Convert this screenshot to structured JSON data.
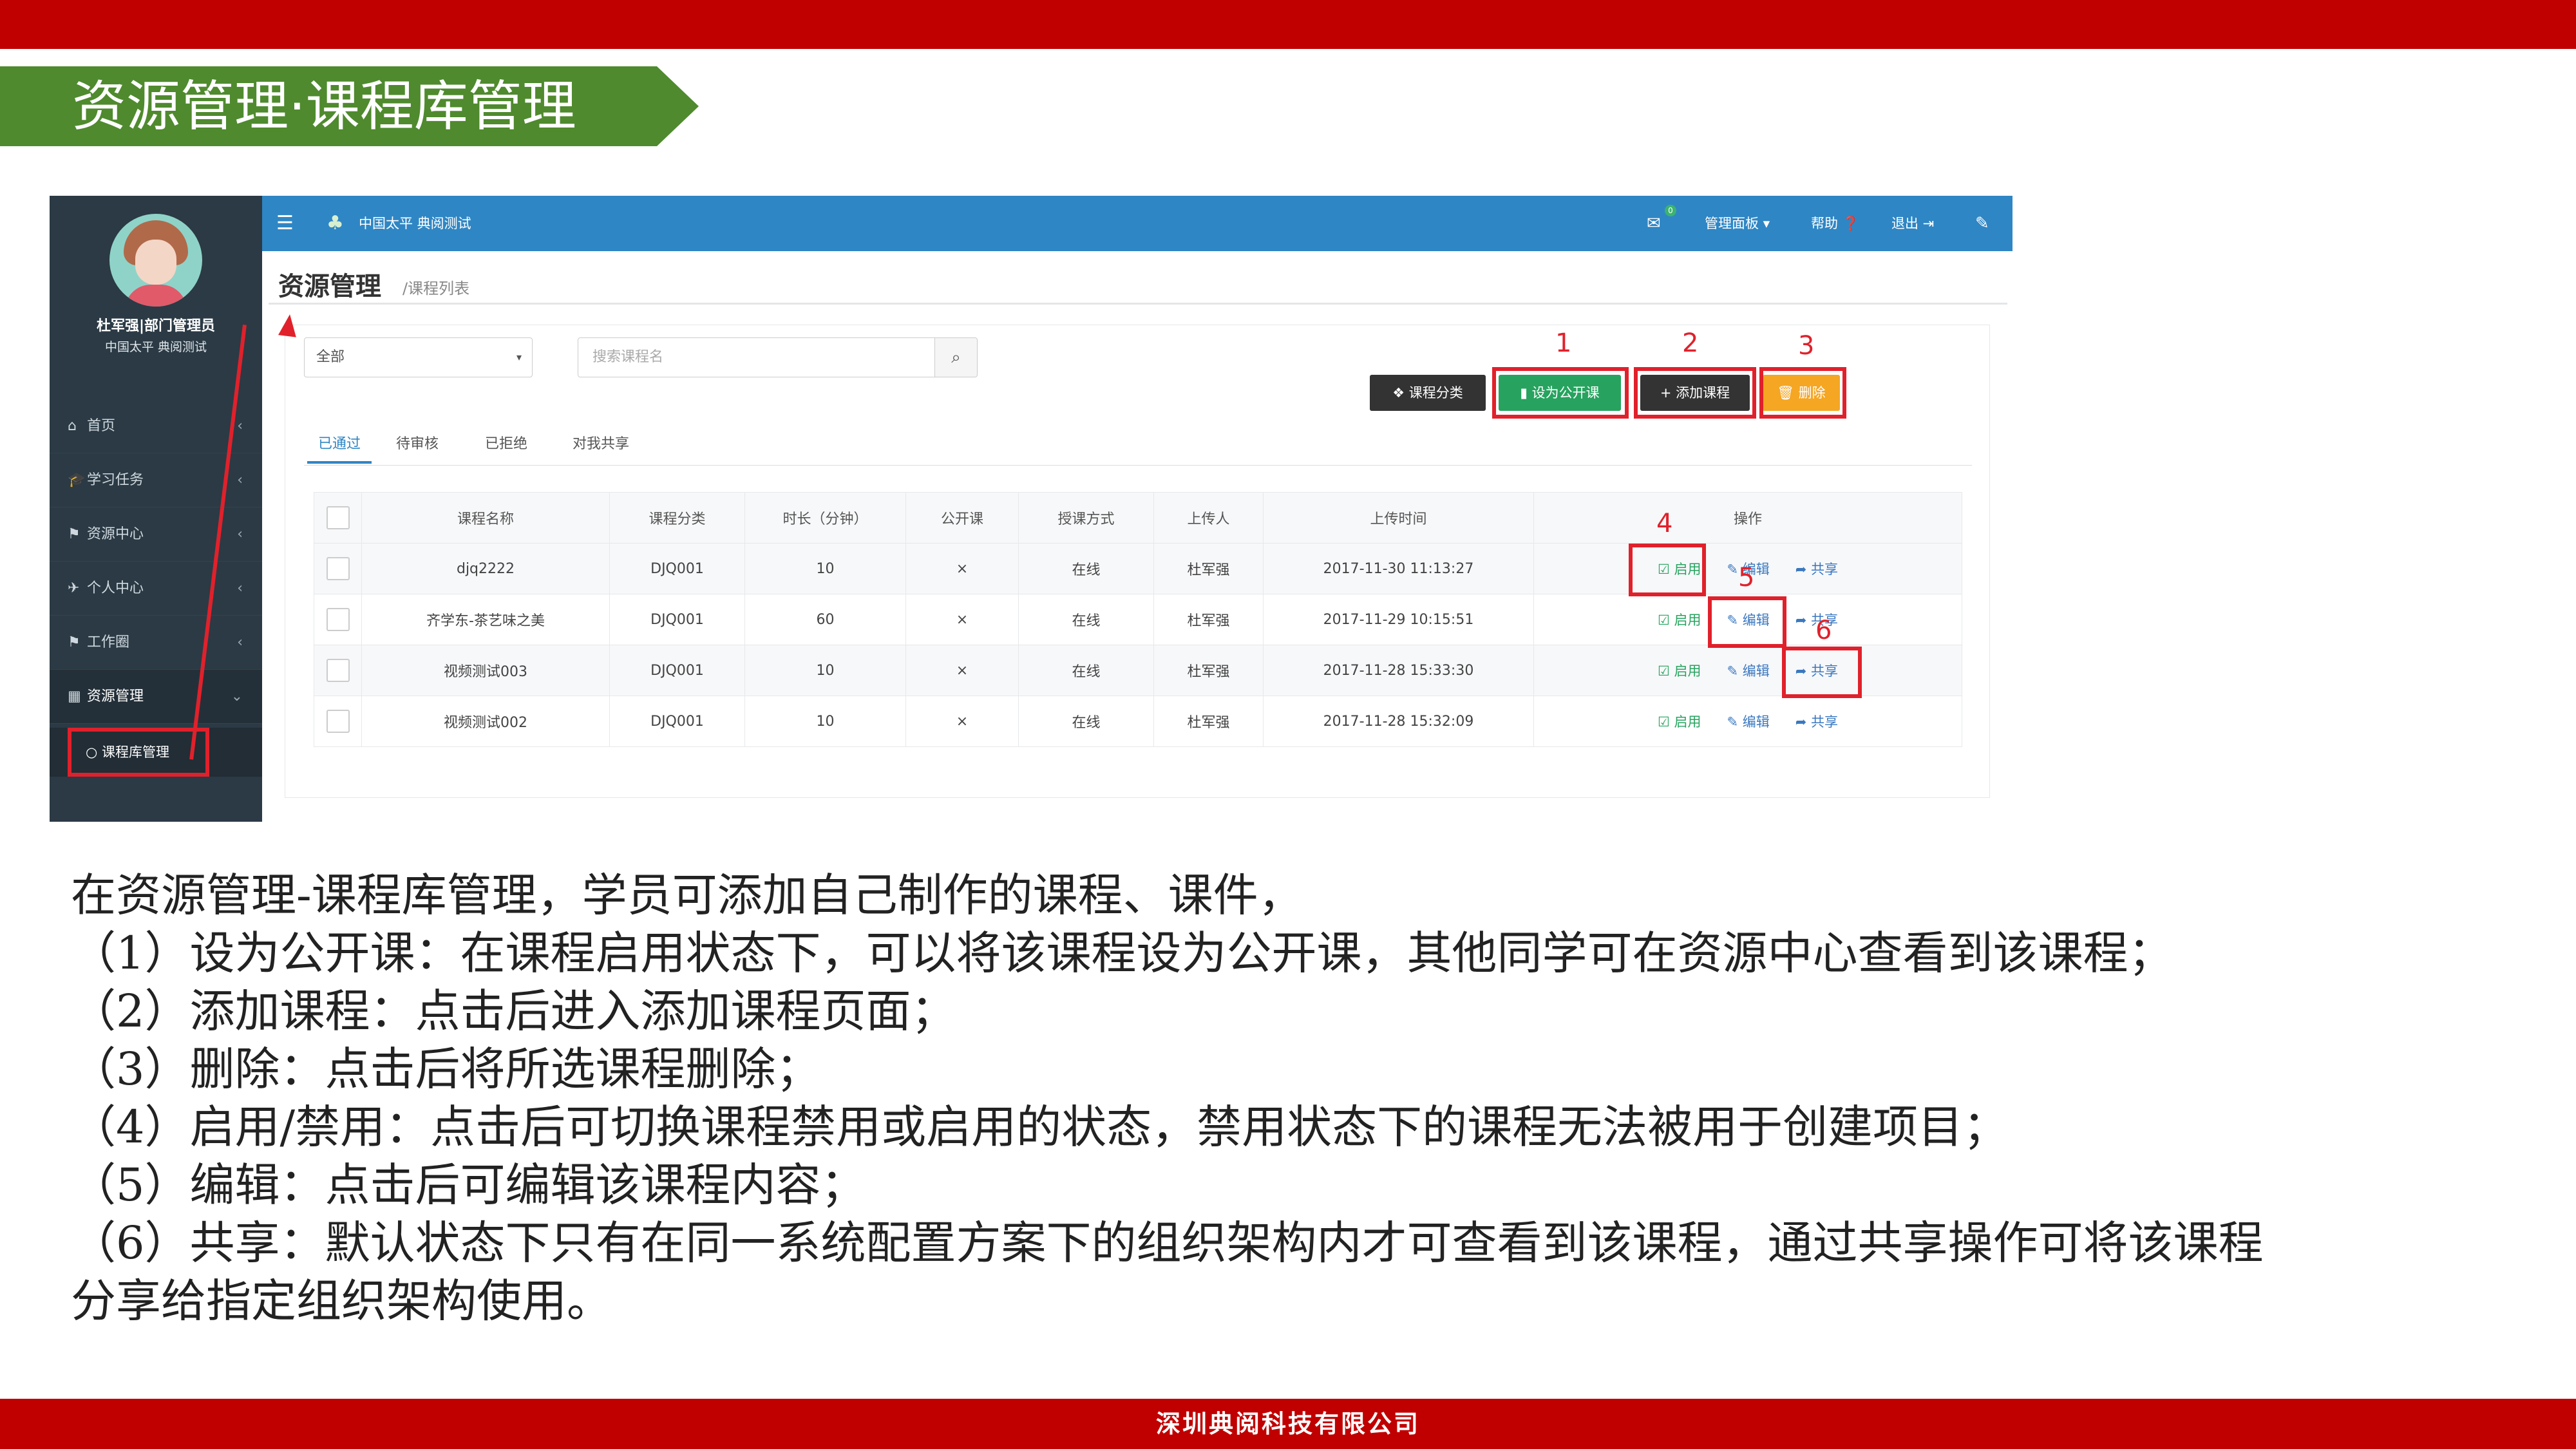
{
  "slide": {
    "title": "资源管理·课程库管理",
    "footer": "深圳典阅科技有限公司"
  },
  "app": {
    "header": {
      "menu_icon": "☰",
      "brand": "中国太平 典阅测试",
      "mail_badge": "0",
      "manage": "管理面板 ▾",
      "help": "帮助 ❓",
      "logout": "退出 ⇥"
    },
    "user": {
      "name": "杜军强|部门管理员",
      "org": "中国太平 典阅测试"
    },
    "sidebar": [
      {
        "icon": "⌂",
        "label": "首页"
      },
      {
        "icon": "🎓",
        "label": "学习任务"
      },
      {
        "icon": "⚑",
        "label": "资源中心"
      },
      {
        "icon": "✈",
        "label": "个人中心"
      },
      {
        "icon": "⚑",
        "label": "工作圈"
      },
      {
        "icon": "▦",
        "label": "资源管理"
      }
    ],
    "sub_item": "课程库管理",
    "page_title": "资源管理",
    "breadcrumb": "/课程列表",
    "filter": {
      "category": "全部",
      "search_placeholder": "搜索课程名"
    },
    "buttons": {
      "category": "课程分类",
      "set_public": "设为公开课",
      "add": "添加课程",
      "delete": "删除"
    },
    "annotations": [
      "1",
      "2",
      "3",
      "4",
      "5",
      "6"
    ],
    "tabs": [
      "已通过",
      "待审核",
      "已拒绝",
      "对我共享"
    ],
    "columns": [
      "课程名称",
      "课程分类",
      "时长（分钟）",
      "公开课",
      "授课方式",
      "上传人",
      "上传时间",
      "操作"
    ],
    "rows": [
      {
        "name": "djq2222",
        "category": "DJQ001",
        "duration": "10",
        "public": "×",
        "mode": "在线",
        "uploader": "杜军强",
        "time": "2017-11-30 11:13:27"
      },
      {
        "name": "齐学东-茶艺味之美",
        "category": "DJQ001",
        "duration": "60",
        "public": "×",
        "mode": "在线",
        "uploader": "杜军强",
        "time": "2017-11-29 10:15:51"
      },
      {
        "name": "视频测试003",
        "category": "DJQ001",
        "duration": "10",
        "public": "×",
        "mode": "在线",
        "uploader": "杜军强",
        "time": "2017-11-28 15:33:30"
      },
      {
        "name": "视频测试002",
        "category": "DJQ001",
        "duration": "10",
        "public": "×",
        "mode": "在线",
        "uploader": "杜军强",
        "time": "2017-11-28 15:32:09"
      }
    ],
    "ops": {
      "enable": "☑ 启用",
      "edit": "✎ 编辑",
      "share": "➦ 共享"
    }
  },
  "description": [
    "在资源管理-课程库管理，学员可添加自己制作的课程、课件，",
    "（1）设为公开课：在课程启用状态下，可以将该课程设为公开课，其他同学可在资源中心查看到该课程；",
    "（2）添加课程：点击后进入添加课程页面；",
    "（3）删除：点击后将所选课程删除；",
    "（4）启用/禁用：点击后可切换课程禁用或启用的状态，禁用状态下的课程无法被用于创建项目；",
    "（5）编辑：点击后可编辑该课程内容；",
    "（6）共享：默认状态下只有在同一系统配置方案下的组织架构内才可查看到该课程，通过共享操作可将该课程",
    "分享给指定组织架构使用。"
  ]
}
